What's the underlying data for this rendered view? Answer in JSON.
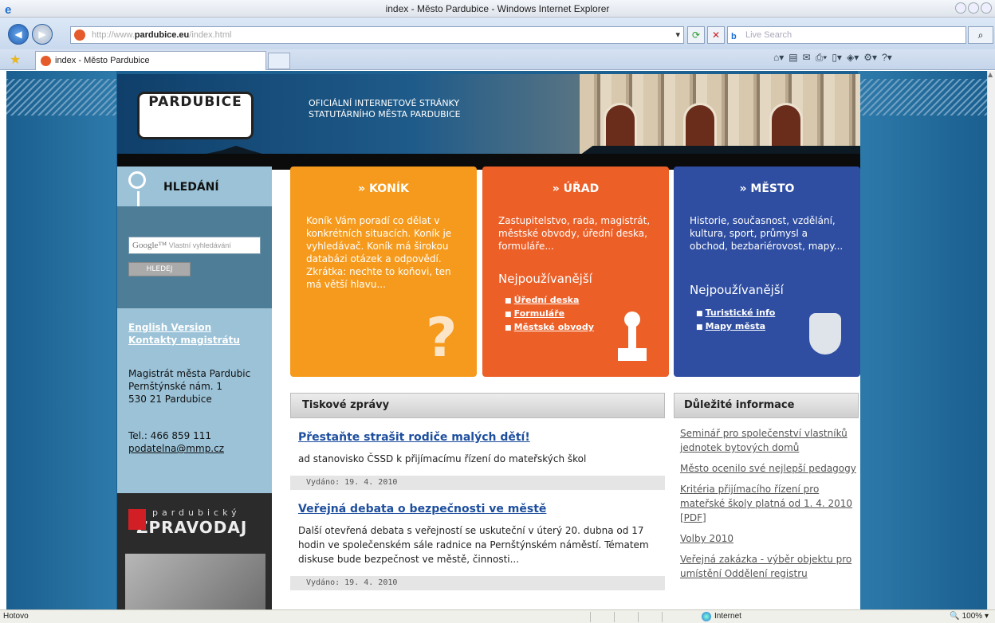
{
  "browser": {
    "title": "index - Město Pardubice - Windows Internet Explorer",
    "url_prefix": "http://www.",
    "url_domain": "pardubice.eu",
    "url_suffix": "/index.html",
    "search_placeholder": "Live Search",
    "tab_label": "index - Město Pardubice",
    "status_left": "Hotovo",
    "status_zone": "Internet",
    "status_zoom": "100%"
  },
  "header": {
    "logo": "PARDUBICE",
    "tagline_1": "OFICIÁLNÍ INTERNETOVÉ STRÁNKY",
    "tagline_2": "STATUTÁRNÍHO MĚSTA PARDUBICE"
  },
  "sidebar": {
    "search_title": "HLEDÁNÍ",
    "google_brand": "Google™",
    "google_placeholder": "Vlastní vyhledávání",
    "search_button": "HLEDEJ",
    "link_english": "English Version",
    "link_contacts": "Kontakty magistrátu",
    "address_1": "Magistrát města Pardubic",
    "address_2": "Pernštýnské nám. 1",
    "address_3": "530 21 Pardubice",
    "tel": "Tel.: 466 859 111",
    "email": "podatelna@mmp.cz",
    "zpravodaj_small": "pardubický",
    "zpravodaj_big": "ZPRAVODAJ"
  },
  "boxes": {
    "konik": {
      "title": "» KONÍK",
      "text": "Koník Vám poradí co dělat v konkrétních situacích. Koník je vyhledávač. Koník má širokou databázi otázek a odpovědí. Zkrátka: nechte to koňovi, ten má větší hlavu..."
    },
    "urad": {
      "title": "» ÚŘAD",
      "text": "Zastupitelstvo, rada, magistrát, městské obvody, úřední deska, formuláře...",
      "np": "Nejpoužívanější",
      "links": [
        "Úřední deska",
        "Formuláře",
        "Městské obvody"
      ]
    },
    "mesto": {
      "title": "» MĚSTO",
      "text": "Historie, současnost, vzdělání, kultura, sport, průmysl a obchod, bezbariérovost, mapy...",
      "np": "Nejpoužívanější",
      "links": [
        "Turistické info",
        "Mapy města"
      ]
    }
  },
  "news": {
    "heading": "Tiskové zprávy",
    "articles": [
      {
        "title": "Přestaňte strašit rodiče malých dětí!",
        "text": "ad stanovisko ČSSD k přijímacímu řízení do mateřských škol",
        "date": "Vydáno: 19. 4. 2010"
      },
      {
        "title": "Veřejná debata o bezpečnosti ve městě",
        "text": "Další otevřená debata s veřejností se uskuteční v úterý 20. dubna od 17 hodin ve společenském sále radnice na Pernštýnském náměstí. Tématem diskuse bude bezpečnost ve městě, činnosti...",
        "date": "Vydáno: 19. 4. 2010"
      }
    ]
  },
  "info": {
    "heading": "Důležité informace",
    "items": [
      "Seminář pro společenství vlastníků jednotek bytových domů",
      "Město ocenilo své nejlepší pedagogy",
      "Kritéria přijímacího řízení pro mateřské školy platná od 1. 4. 2010 [PDF]",
      "Volby 2010",
      "Veřejná zakázka - výběr objektu pro umístění Oddělení registru"
    ]
  }
}
